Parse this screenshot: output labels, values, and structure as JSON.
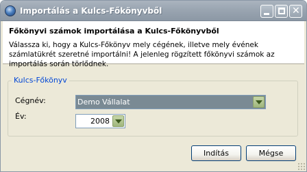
{
  "window": {
    "title": "Importálás a Kulcs-Főkönyvből"
  },
  "header": {
    "title": "Főkönyvi számok importálása a Kulcs-Főkönyvből",
    "description": "Válassza ki, hogy a Kulcs-Főkönyv mely cégének, illetve mely évének számlatükrét szeretné importálni! A  jelenleg rögzített főkönyvi számok az importálás során törlődnek."
  },
  "group": {
    "legend": "Kulcs-Főkönyv",
    "company_label": "Cégnév:",
    "company_value": "Demo Vállalat",
    "year_label": "Év:",
    "year_value": "2008"
  },
  "buttons": {
    "start": "Indítás",
    "cancel": "Mégse"
  },
  "icons": {
    "app": "app-icon",
    "minimize": "minimize-icon",
    "maximize": "maximize-icon",
    "close": "close-icon",
    "dropdown": "chevron-down-icon"
  },
  "colors": {
    "title_bar": "#9aa5b1",
    "legend_text": "#0046d5",
    "dialog_bg": "#ece9d8",
    "selected_combo_bg": "#7a8a94"
  }
}
